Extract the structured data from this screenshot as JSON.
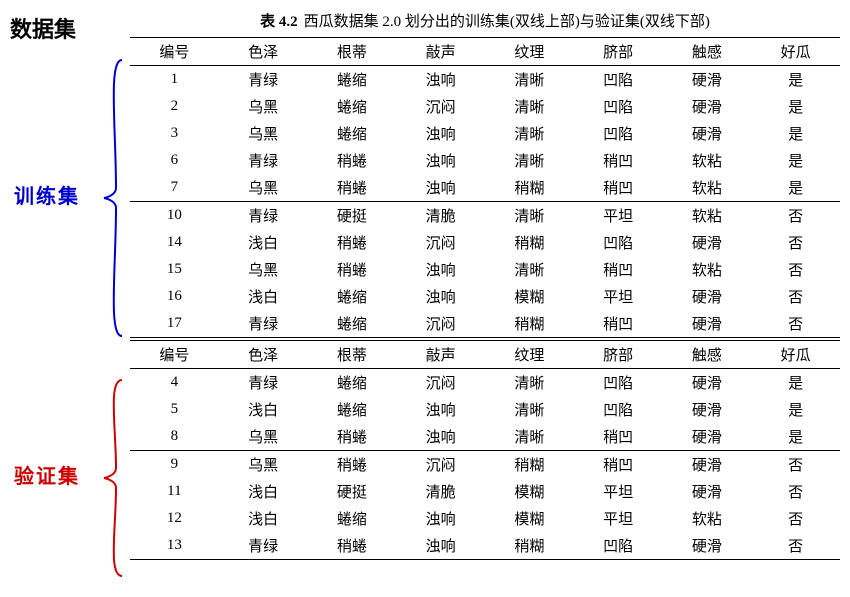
{
  "title": "数据集",
  "caption_bold": "表 4.2",
  "caption_rest": "西瓜数据集 2.0 划分出的训练集(双线上部)与验证集(双线下部)",
  "headers": [
    "编号",
    "色泽",
    "根蒂",
    "敲声",
    "纹理",
    "脐部",
    "触感",
    "好瓜"
  ],
  "train_label": "训练集",
  "valid_label": "验证集",
  "chart_data": {
    "type": "table",
    "columns": [
      "编号",
      "色泽",
      "根蒂",
      "敲声",
      "纹理",
      "脐部",
      "触感",
      "好瓜"
    ],
    "training_set": [
      [
        1,
        "青绿",
        "蜷缩",
        "浊响",
        "清晰",
        "凹陷",
        "硬滑",
        "是"
      ],
      [
        2,
        "乌黑",
        "蜷缩",
        "沉闷",
        "清晰",
        "凹陷",
        "硬滑",
        "是"
      ],
      [
        3,
        "乌黑",
        "蜷缩",
        "浊响",
        "清晰",
        "凹陷",
        "硬滑",
        "是"
      ],
      [
        6,
        "青绿",
        "稍蜷",
        "浊响",
        "清晰",
        "稍凹",
        "软粘",
        "是"
      ],
      [
        7,
        "乌黑",
        "稍蜷",
        "浊响",
        "稍糊",
        "稍凹",
        "软粘",
        "是"
      ],
      [
        10,
        "青绿",
        "硬挺",
        "清脆",
        "清晰",
        "平坦",
        "软粘",
        "否"
      ],
      [
        14,
        "浅白",
        "稍蜷",
        "沉闷",
        "稍糊",
        "凹陷",
        "硬滑",
        "否"
      ],
      [
        15,
        "乌黑",
        "稍蜷",
        "浊响",
        "清晰",
        "稍凹",
        "软粘",
        "否"
      ],
      [
        16,
        "浅白",
        "蜷缩",
        "浊响",
        "模糊",
        "平坦",
        "硬滑",
        "否"
      ],
      [
        17,
        "青绿",
        "蜷缩",
        "沉闷",
        "稍糊",
        "稍凹",
        "硬滑",
        "否"
      ]
    ],
    "validation_set": [
      [
        4,
        "青绿",
        "蜷缩",
        "沉闷",
        "清晰",
        "凹陷",
        "硬滑",
        "是"
      ],
      [
        5,
        "浅白",
        "蜷缩",
        "浊响",
        "清晰",
        "凹陷",
        "硬滑",
        "是"
      ],
      [
        8,
        "乌黑",
        "稍蜷",
        "浊响",
        "清晰",
        "稍凹",
        "硬滑",
        "是"
      ],
      [
        9,
        "乌黑",
        "稍蜷",
        "沉闷",
        "稍糊",
        "稍凹",
        "硬滑",
        "否"
      ],
      [
        11,
        "浅白",
        "硬挺",
        "清脆",
        "模糊",
        "平坦",
        "硬滑",
        "否"
      ],
      [
        12,
        "浅白",
        "蜷缩",
        "浊响",
        "模糊",
        "平坦",
        "软粘",
        "否"
      ],
      [
        13,
        "青绿",
        "稍蜷",
        "浊响",
        "稍糊",
        "凹陷",
        "硬滑",
        "否"
      ]
    ]
  }
}
